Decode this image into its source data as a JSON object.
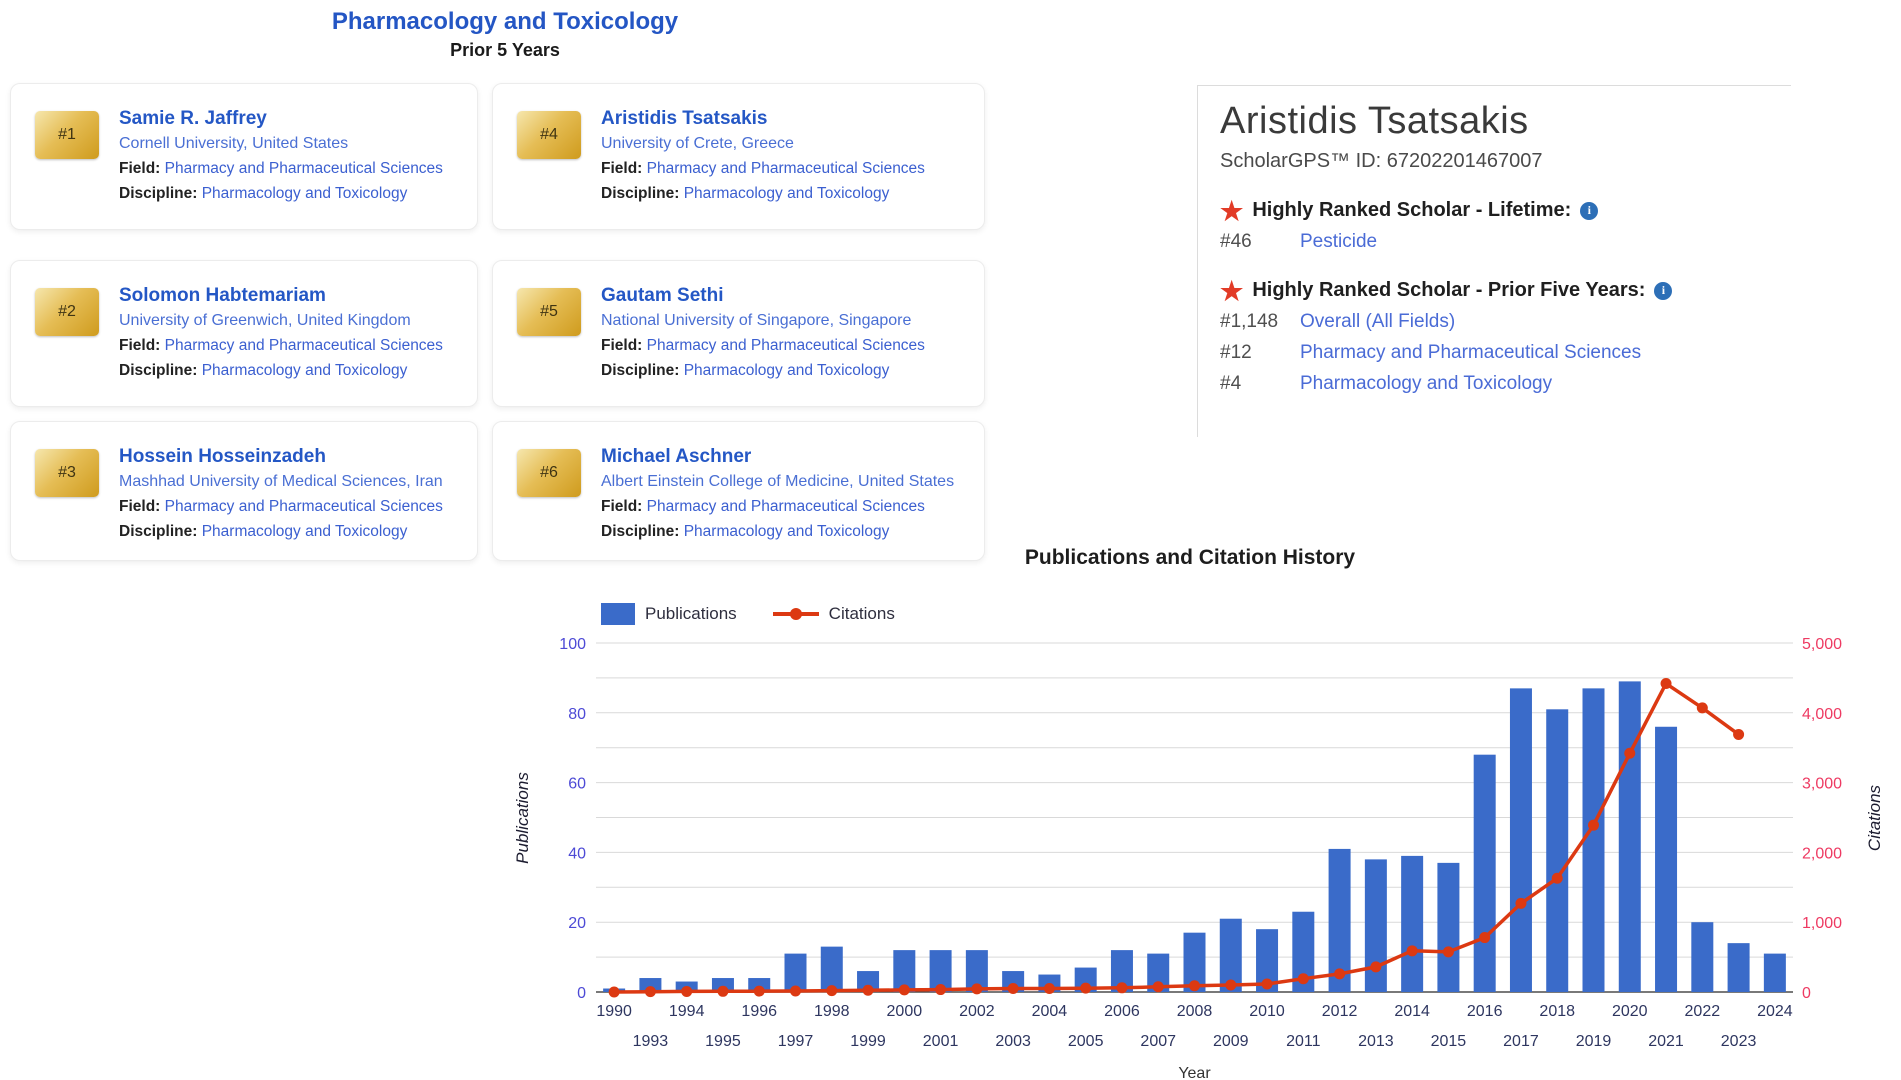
{
  "header": {
    "title": "Pharmacology and Toxicology",
    "subtitle": "Prior 5 Years"
  },
  "cards": [
    {
      "rank": "#1",
      "name": "Samie R. Jaffrey",
      "institution": "Cornell University, United States",
      "field_label": "Field:",
      "field": "Pharmacy and Pharmaceutical Sciences",
      "discipline_label": "Discipline:",
      "discipline": "Pharmacology and Toxicology"
    },
    {
      "rank": "#2",
      "name": "Solomon Habtemariam",
      "institution": "University of Greenwich, United Kingdom",
      "field_label": "Field:",
      "field": "Pharmacy and Pharmaceutical Sciences",
      "discipline_label": "Discipline:",
      "discipline": "Pharmacology and Toxicology"
    },
    {
      "rank": "#3",
      "name": "Hossein Hosseinzadeh",
      "institution": "Mashhad University of Medical Sciences, Iran",
      "field_label": "Field:",
      "field": "Pharmacy and Pharmaceutical Sciences",
      "discipline_label": "Discipline:",
      "discipline": "Pharmacology and Toxicology"
    },
    {
      "rank": "#4",
      "name": "Aristidis Tsatsakis",
      "institution": "University of Crete, Greece",
      "field_label": "Field:",
      "field": "Pharmacy and Pharmaceutical Sciences",
      "discipline_label": "Discipline:",
      "discipline": "Pharmacology and Toxicology"
    },
    {
      "rank": "#5",
      "name": "Gautam Sethi",
      "institution": "National University of Singapore, Singapore",
      "field_label": "Field:",
      "field": "Pharmacy and Pharmaceutical Sciences",
      "discipline_label": "Discipline:",
      "discipline": "Pharmacology and Toxicology"
    },
    {
      "rank": "#6",
      "name": "Michael Aschner",
      "institution": "Albert Einstein College of Medicine, United States",
      "field_label": "Field:",
      "field": "Pharmacy and Pharmaceutical Sciences",
      "discipline_label": "Discipline:",
      "discipline": "Pharmacology and Toxicology"
    }
  ],
  "profile": {
    "name": "Aristidis Tsatsakis",
    "id_line": "ScholarGPS™ ID: 67202201467007",
    "sections": [
      {
        "heading": "Highly Ranked Scholar - Lifetime:",
        "rows": [
          {
            "rank": "#46",
            "link": "Pesticide"
          }
        ]
      },
      {
        "heading": "Highly Ranked Scholar - Prior Five Years:",
        "rows": [
          {
            "rank": "#1,148",
            "link": "Overall (All Fields)"
          },
          {
            "rank": "#12",
            "link": "Pharmacy and Pharmaceutical Sciences"
          },
          {
            "rank": "#4",
            "link": "Pharmacology and Toxicology"
          }
        ]
      }
    ]
  },
  "chart_data": {
    "type": "bar+line",
    "title": "Publications and Citation History",
    "xlabel": "Year",
    "legend": [
      {
        "label": "Publications",
        "type": "bar",
        "color": "#3a6bc9"
      },
      {
        "label": "Citations",
        "type": "line",
        "color": "#dc3912"
      }
    ],
    "left_axis": {
      "label": "Publications",
      "min": 0,
      "max": 100,
      "ticks": [
        0,
        20,
        40,
        60,
        80,
        100
      ],
      "tick_color": "#4d4ad6"
    },
    "right_axis": {
      "label": "Citations",
      "min": 0,
      "max": 5000,
      "ticks": [
        "0",
        "1,000",
        "2,000",
        "3,000",
        "4,000",
        "5,000"
      ],
      "tick_color": "#ee3a62"
    },
    "categories": [
      "1990",
      "1993",
      "1994",
      "1995",
      "1996",
      "1997",
      "1998",
      "1999",
      "2000",
      "2001",
      "2002",
      "2003",
      "2004",
      "2005",
      "2006",
      "2007",
      "2008",
      "2009",
      "2010",
      "2011",
      "2012",
      "2013",
      "2014",
      "2015",
      "2016",
      "2017",
      "2018",
      "2019",
      "2020",
      "2021",
      "2022",
      "2023",
      "2024"
    ],
    "series": [
      {
        "name": "Publications",
        "values": [
          1,
          4,
          3,
          4,
          4,
          11,
          13,
          6,
          12,
          12,
          12,
          6,
          5,
          7,
          12,
          11,
          17,
          21,
          18,
          23,
          41,
          38,
          39,
          37,
          68,
          87,
          81,
          87,
          89,
          76,
          20,
          14,
          11
        ]
      },
      {
        "name": "Citations",
        "values": [
          0,
          5,
          8,
          10,
          12,
          15,
          20,
          25,
          30,
          35,
          45,
          50,
          50,
          55,
          60,
          75,
          90,
          100,
          115,
          190,
          260,
          360,
          590,
          575,
          780,
          1270,
          1630,
          2390,
          3420,
          4420,
          4070,
          3690,
          null
        ]
      }
    ],
    "grid": {
      "on": true,
      "step": 10,
      "color": "#d9d9d9",
      "baseline_color": "#4d4d4d"
    },
    "tick_label_color_x": "#2e3660"
  },
  "colors": {
    "header_blue": "#2456c4",
    "card_link_blue": "#3b5fd0",
    "badge_gold": "#d9a627",
    "star_red": "#e23b27",
    "info_blue": "#2d6fb7",
    "bar_blue": "#3a6bc9",
    "line_red": "#dc3912"
  }
}
